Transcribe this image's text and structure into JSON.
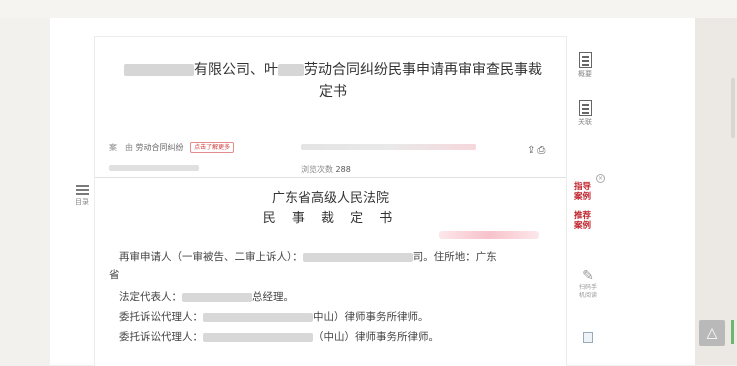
{
  "title": {
    "line1_part1": "有限公司、叶",
    "line1_part2": "劳动合同纠纷民事申请再审审查民事裁",
    "line2": "定书"
  },
  "meta": {
    "case_label": "案　由",
    "case_value": "劳动合同纠纷",
    "more_tag": "点击了解更多",
    "views_label": "浏览次数",
    "views_value": "288"
  },
  "icons": {
    "download": "download-icon",
    "print": "print-icon"
  },
  "court": "广东省高级人民法院",
  "doc_type": "民 事 裁 定 书",
  "body": {
    "line1_a": "再审申请人（一审被告、二审上诉人）：",
    "line1_b": "司。住所地：广东",
    "line2": "省",
    "line3_a": "法定代表人：",
    "line3_b": "总经理。",
    "line4_a": "委托诉讼代理人：",
    "line4_b": "中山）律师事务所律师。",
    "line5_a": "委托诉讼代理人：",
    "line5_b": "（中山）律师事务所律师。"
  },
  "toc": {
    "label": "目录"
  },
  "right_sidebar": {
    "summary_label": "概要",
    "related_label": "关联",
    "guide_label_1": "指导",
    "guide_label_2": "案例",
    "recommend_label_1": "推荐",
    "recommend_label_2": "案例",
    "scan_label_1": "扫码手",
    "scan_label_2": "机阅读"
  },
  "colors": {
    "accent_red": "#c0232c",
    "page_bg": "#f3f1ee"
  }
}
